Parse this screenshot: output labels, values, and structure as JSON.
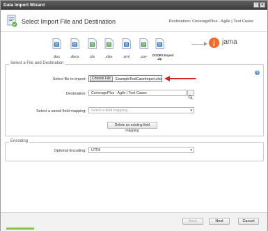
{
  "window": {
    "title": "Data Import Wizard"
  },
  "header": {
    "step_title": "Select Import File and Destination",
    "destination": "Destination: CoveragePlus - Agile | Test Cases"
  },
  "formats": [
    {
      "label": ".doc",
      "color": "#2f6fb3"
    },
    {
      "label": ".docx",
      "color": "#2f6fb3"
    },
    {
      "label": ".xls",
      "color": "#3a9a3a"
    },
    {
      "label": ".xlsx",
      "color": "#3a9a3a"
    },
    {
      "label": ".xml",
      "color": "#2f6fb3"
    },
    {
      "label": ".csv",
      "color": "#3a9a3a"
    },
    {
      "label": "DOORS Export\n.zip",
      "color": "#2f6fb3"
    }
  ],
  "brand": {
    "logo_letter": "j",
    "name": "jama",
    "color": "#ef6c2a"
  },
  "section_file": {
    "legend": "Select a File and Destination",
    "file_label": "Select file to import:",
    "choose_button": "Choose File",
    "file_name": "ExampleTestCaseImport.xlsx",
    "destination_label": "Destination:",
    "destination_value": "CoveragePlus - Agile | Test Cases",
    "mapping_label": "Select a saved field mapping:",
    "mapping_placeholder": "Select a field mapping...",
    "delete_button": "Delete an existing field mapping"
  },
  "section_encoding": {
    "legend": "Encoding",
    "encoding_label": "Optional Encoding:",
    "encoding_value": "UTF8"
  },
  "footer": {
    "back": "Back",
    "next": "Next",
    "cancel": "Cancel"
  },
  "colors": {
    "accent_red": "#d0262a",
    "title_bar": "#4a4a4a"
  }
}
